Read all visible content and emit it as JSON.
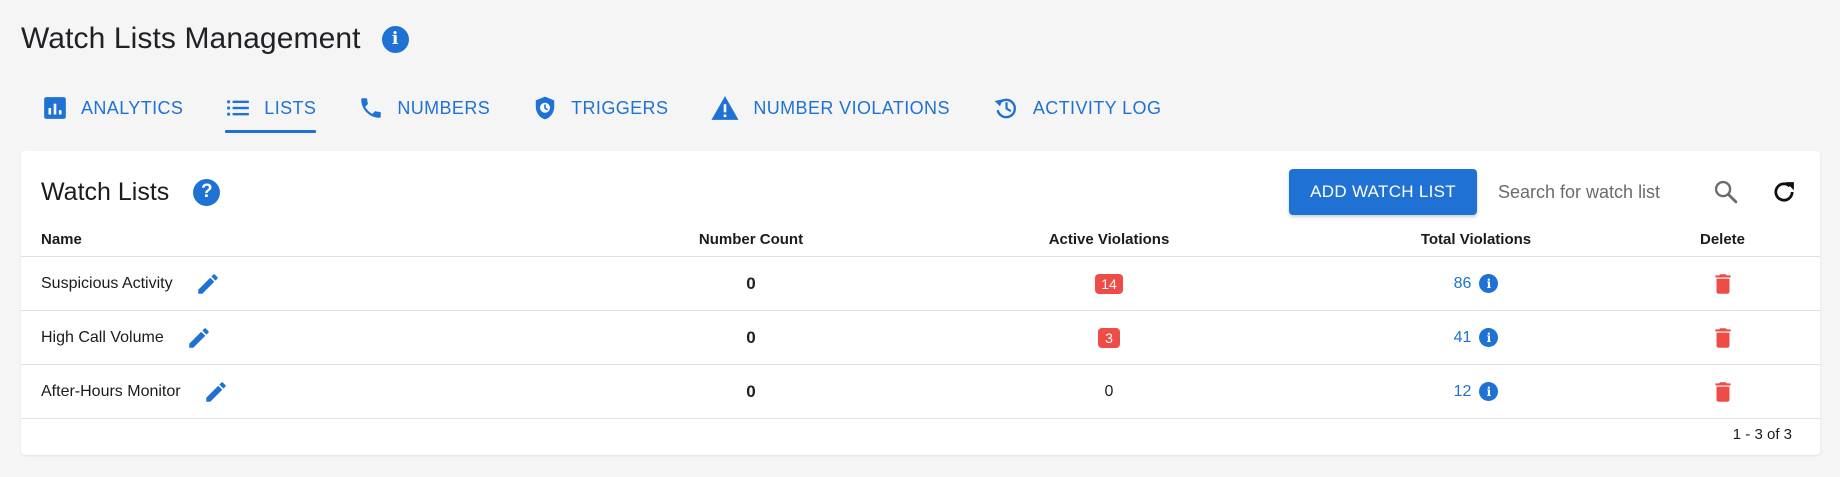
{
  "page": {
    "title": "Watch Lists Management",
    "info_icon": "info-circle-icon"
  },
  "tabs": [
    {
      "label": "ANALYTICS",
      "icon": "analytics-icon",
      "active": false
    },
    {
      "label": "LISTS",
      "icon": "list-icon",
      "active": true
    },
    {
      "label": "NUMBERS",
      "icon": "phone-icon",
      "active": false
    },
    {
      "label": "TRIGGERS",
      "icon": "shield-clock-icon",
      "active": false
    },
    {
      "label": "NUMBER VIOLATIONS",
      "icon": "warning-icon",
      "active": false
    },
    {
      "label": "ACTIVITY LOG",
      "icon": "history-icon",
      "active": false
    }
  ],
  "card": {
    "title": "Watch Lists",
    "add_button": "ADD WATCH LIST",
    "search_placeholder": "Search for watch list"
  },
  "table": {
    "columns": [
      "Name",
      "Number Count",
      "Active Violations",
      "Total Violations",
      "Delete"
    ],
    "rows": [
      {
        "name": "Suspicious Activity",
        "number_count": "0",
        "active_violations": "14",
        "active_badge": true,
        "total_violations": "86"
      },
      {
        "name": "High Call Volume",
        "number_count": "0",
        "active_violations": "3",
        "active_badge": true,
        "total_violations": "41"
      },
      {
        "name": "After-Hours Monitor",
        "number_count": "0",
        "active_violations": "0",
        "active_badge": false,
        "total_violations": "12"
      }
    ]
  },
  "pagination": {
    "text": "1 - 3 of 3"
  },
  "colors": {
    "primary": "#1f72d3",
    "danger": "#ee4c47",
    "background": "#f5f5f5"
  }
}
